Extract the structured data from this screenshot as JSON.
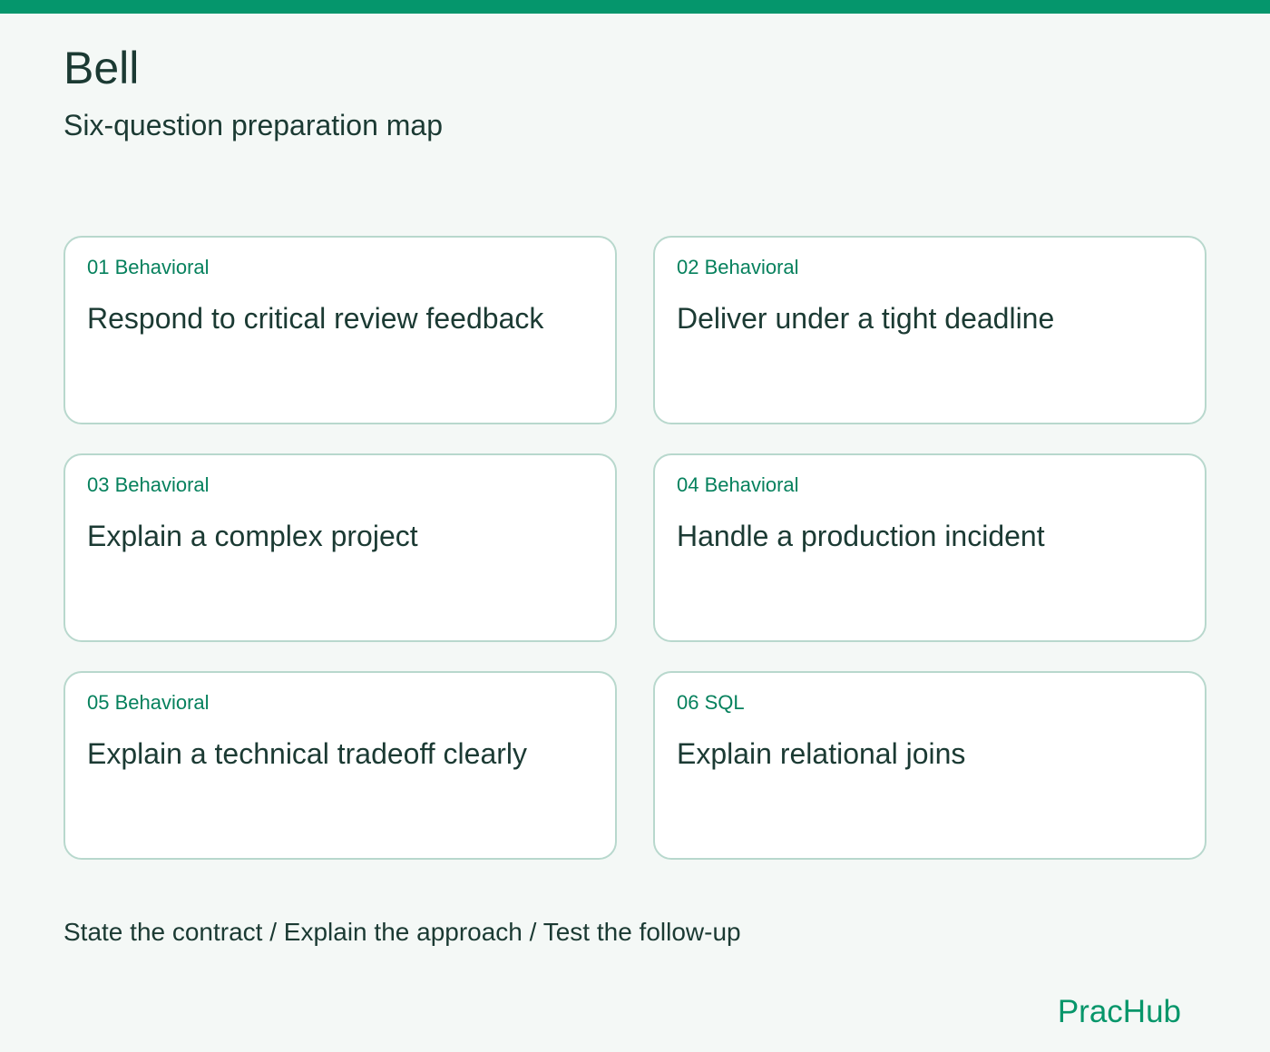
{
  "colors": {
    "accent": "#05966c",
    "tag": "#06815d",
    "text": "#1b3a33",
    "card_border": "#b8d8cd",
    "background": "#f4f8f6"
  },
  "header": {
    "title": "Bell",
    "subtitle": "Six-question preparation map"
  },
  "cards": [
    {
      "tag": "01 Behavioral",
      "title": "Respond to critical review feedback"
    },
    {
      "tag": "02 Behavioral",
      "title": "Deliver under a tight deadline"
    },
    {
      "tag": "03 Behavioral",
      "title": "Explain a complex project"
    },
    {
      "tag": "04 Behavioral",
      "title": "Handle a production incident"
    },
    {
      "tag": "05 Behavioral",
      "title": "Explain a technical tradeoff clearly"
    },
    {
      "tag": "06 SQL",
      "title": "Explain relational joins"
    }
  ],
  "footer": {
    "note": "State the contract / Explain the approach / Test the follow-up",
    "brand": "PracHub"
  }
}
